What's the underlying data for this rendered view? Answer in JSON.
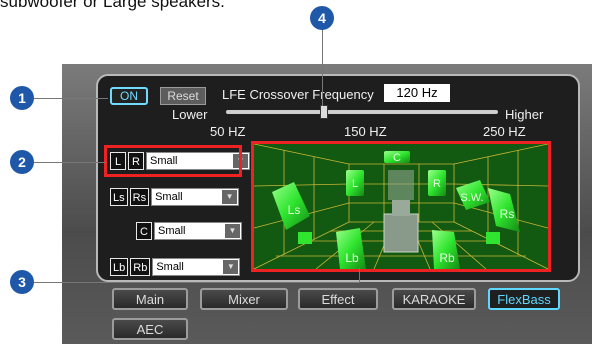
{
  "top_text": "subwoofer or Large speakers.",
  "controls": {
    "on_label": "ON",
    "reset_label": "Reset"
  },
  "lfe": {
    "label": "LFE Crossover Frequency",
    "value": "120 Hz",
    "lower_label": "Lower",
    "higher_label": "Higher",
    "ticks": [
      "50 HZ",
      "150 HZ",
      "250 HZ"
    ],
    "slider_level": 0.36
  },
  "channels": [
    {
      "a": "L",
      "b": "R",
      "size": "Small"
    },
    {
      "a": "Ls",
      "b": "Rs",
      "size": "Small"
    },
    {
      "a": "",
      "b": "C",
      "size": "Small"
    },
    {
      "a": "Lb",
      "b": "Rb",
      "size": "Small"
    }
  ],
  "speakers": {
    "c": "C",
    "l": "L",
    "r": "R",
    "sw": "S.W.",
    "ls": "Ls",
    "rs": "Rs",
    "lb": "Lb",
    "rb": "Rb"
  },
  "tabs": [
    "Main",
    "Mixer",
    "Effect",
    "KARAOKE",
    "FlexBass",
    "AEC"
  ],
  "active_tab": "FlexBass",
  "callouts": [
    "1",
    "2",
    "3",
    "4"
  ],
  "colors": {
    "accent": "#5fd8ff",
    "highlight": "#e22222",
    "speaker_green": "#2fe52f",
    "badge": "#1f58a8"
  }
}
